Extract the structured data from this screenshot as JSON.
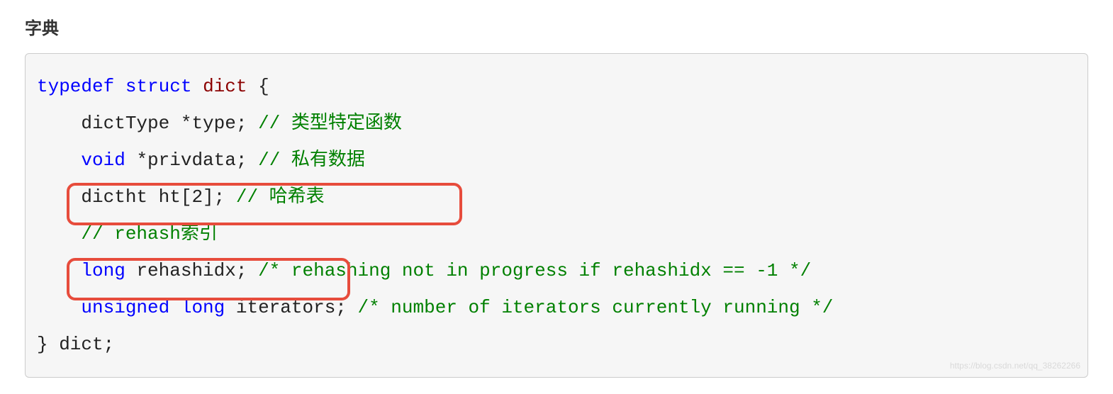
{
  "title": "字典",
  "code": {
    "line1": {
      "typedef": "typedef",
      "struct": "struct",
      "name": "dict",
      "brace": " {"
    },
    "line2": {
      "indent": "    ",
      "type": "dictType *type;",
      "comment": " // 类型特定函数"
    },
    "line3": {
      "indent": "    ",
      "void": "void",
      "rest": " *privdata;",
      "comment": " // 私有数据"
    },
    "line4": {
      "indent": "    ",
      "text": "dictht ht[2];",
      "comment": " // 哈希表"
    },
    "line5": {
      "indent": "    ",
      "comment": "// rehash索引"
    },
    "line6": {
      "indent": "    ",
      "long": "long",
      "var": " rehashidx; ",
      "comment": "/* rehashing not in progress if rehashidx == -1 */"
    },
    "line7": {
      "indent": "    ",
      "unsigned": "unsigned",
      "long": " long",
      "var": " iterators; ",
      "comment": "/* number of iterators currently running */"
    },
    "line8": {
      "text": "} dict;"
    }
  },
  "watermark": "https://blog.csdn.net/qq_38262266"
}
